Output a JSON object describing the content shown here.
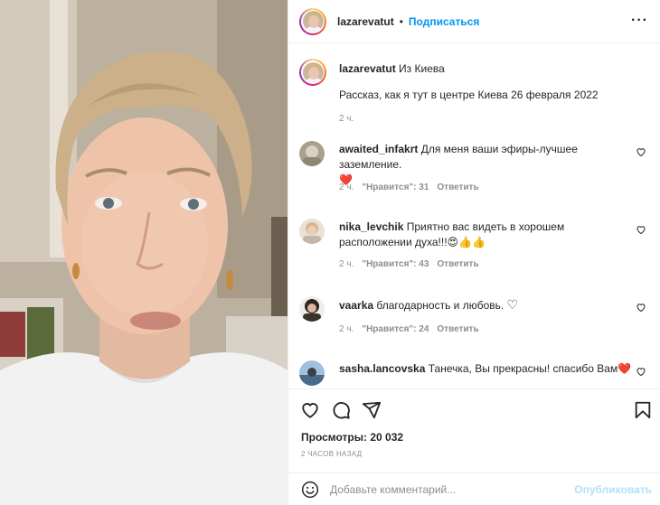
{
  "header": {
    "username": "lazarevatut",
    "separator": "•",
    "follow_label": "Подписаться",
    "more_icon": "more-horizontal-icon"
  },
  "caption": {
    "username": "lazarevatut",
    "title": "Из Киева",
    "body": "Рассказ, как я тут в центре Киева 26 февраля 2022",
    "time": "2 ч."
  },
  "comments": [
    {
      "username": "awaited_infakrt",
      "text": "Для меня ваши эфиры-лучшее заземление.",
      "emoji": "❤️",
      "time": "2 ч.",
      "likes": "\"Нравится\": 31",
      "reply": "Ответить"
    },
    {
      "username": "nika_levchik",
      "text": "Приятно вас видеть в хорошем расположении духа!!!",
      "emoji": "😍👍👍",
      "time": "2 ч.",
      "likes": "\"Нравится\": 43",
      "reply": "Ответить"
    },
    {
      "username": "vaarka",
      "text": "благодарность и любовь.",
      "emoji": "♡",
      "time": "2 ч.",
      "likes": "\"Нравится\": 24",
      "reply": "Ответить"
    },
    {
      "username": "sasha.lancovska",
      "text": "Танечка, Вы прекрасны! спасибо Вам",
      "emoji": "❤️"
    }
  ],
  "actions": {
    "icons": [
      "heart-icon",
      "comment-icon",
      "share-icon",
      "bookmark-icon"
    ],
    "views": "Просмотры: 20 032",
    "ago": "2 ЧАСОВ НАЗАД"
  },
  "add_comment": {
    "placeholder": "Добавьте комментарий...",
    "post_label": "Опубликовать"
  },
  "colors": {
    "link": "#0095f6",
    "post_disabled": "#b2dffc",
    "secondary_text": "#8e8e8e",
    "heart": "#ed4956"
  }
}
